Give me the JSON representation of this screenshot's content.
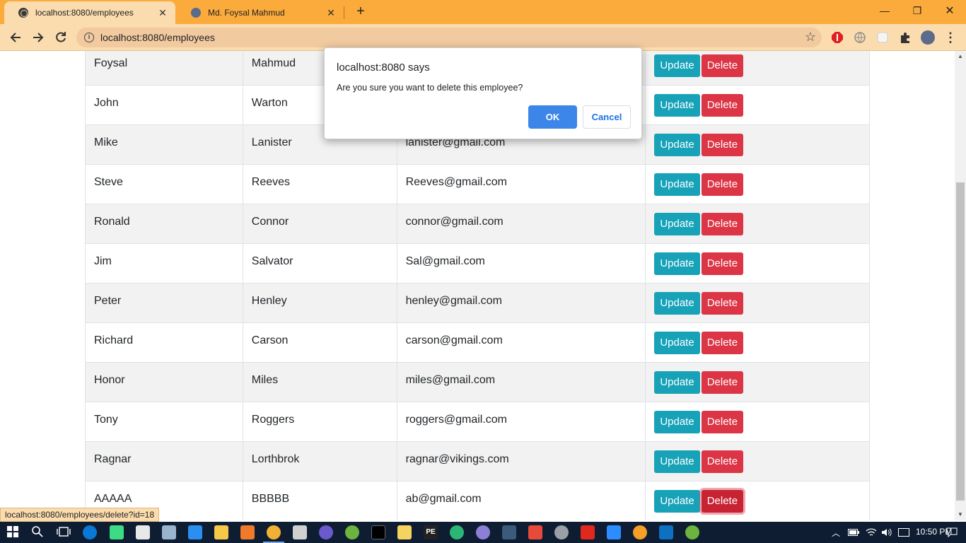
{
  "browser": {
    "tabs": [
      {
        "title": "localhost:8080/employees",
        "active": true,
        "icon": "globe-icon"
      },
      {
        "title": "Md. Foysal Mahmud",
        "active": false,
        "icon": "avatar-icon"
      }
    ],
    "url": "localhost:8080/employees",
    "new_tab_label": "+",
    "status_link": "localhost:8080/employees/delete?id=18"
  },
  "table": {
    "update_label": "Update",
    "delete_label": "Delete",
    "rows": [
      {
        "first": "Foysal",
        "last": "Mahmud",
        "email": ""
      },
      {
        "first": "John",
        "last": "Warton",
        "email": ""
      },
      {
        "first": "Mike",
        "last": "Lanister",
        "email": "lanister@gmail.com"
      },
      {
        "first": "Steve",
        "last": "Reeves",
        "email": "Reeves@gmail.com"
      },
      {
        "first": "Ronald",
        "last": "Connor",
        "email": "connor@gmail.com"
      },
      {
        "first": "Jim",
        "last": "Salvator",
        "email": "Sal@gmail.com"
      },
      {
        "first": "Peter",
        "last": "Henley",
        "email": "henley@gmail.com"
      },
      {
        "first": "Richard",
        "last": "Carson",
        "email": "carson@gmail.com"
      },
      {
        "first": "Honor",
        "last": "Miles",
        "email": "miles@gmail.com"
      },
      {
        "first": "Tony",
        "last": "Roggers",
        "email": "roggers@gmail.com"
      },
      {
        "first": "Ragnar",
        "last": "Lorthbrok",
        "email": "ragnar@vikings.com"
      },
      {
        "first": "AAAAA",
        "last": "BBBBB",
        "email": "ab@gmail.com"
      }
    ]
  },
  "dialog": {
    "title": "localhost:8080 says",
    "message": "Are you sure you want to delete this employee?",
    "ok_label": "OK",
    "cancel_label": "Cancel"
  },
  "taskbar": {
    "time": "10:50 PM"
  },
  "colors": {
    "chrome_tabstrip": "#fbaa3c",
    "chrome_toolbar": "#fbdcae",
    "update_button": "#17a2b8",
    "delete_button": "#dc3545",
    "dialog_ok": "#3b86e8",
    "taskbar": "#0f1d33"
  }
}
